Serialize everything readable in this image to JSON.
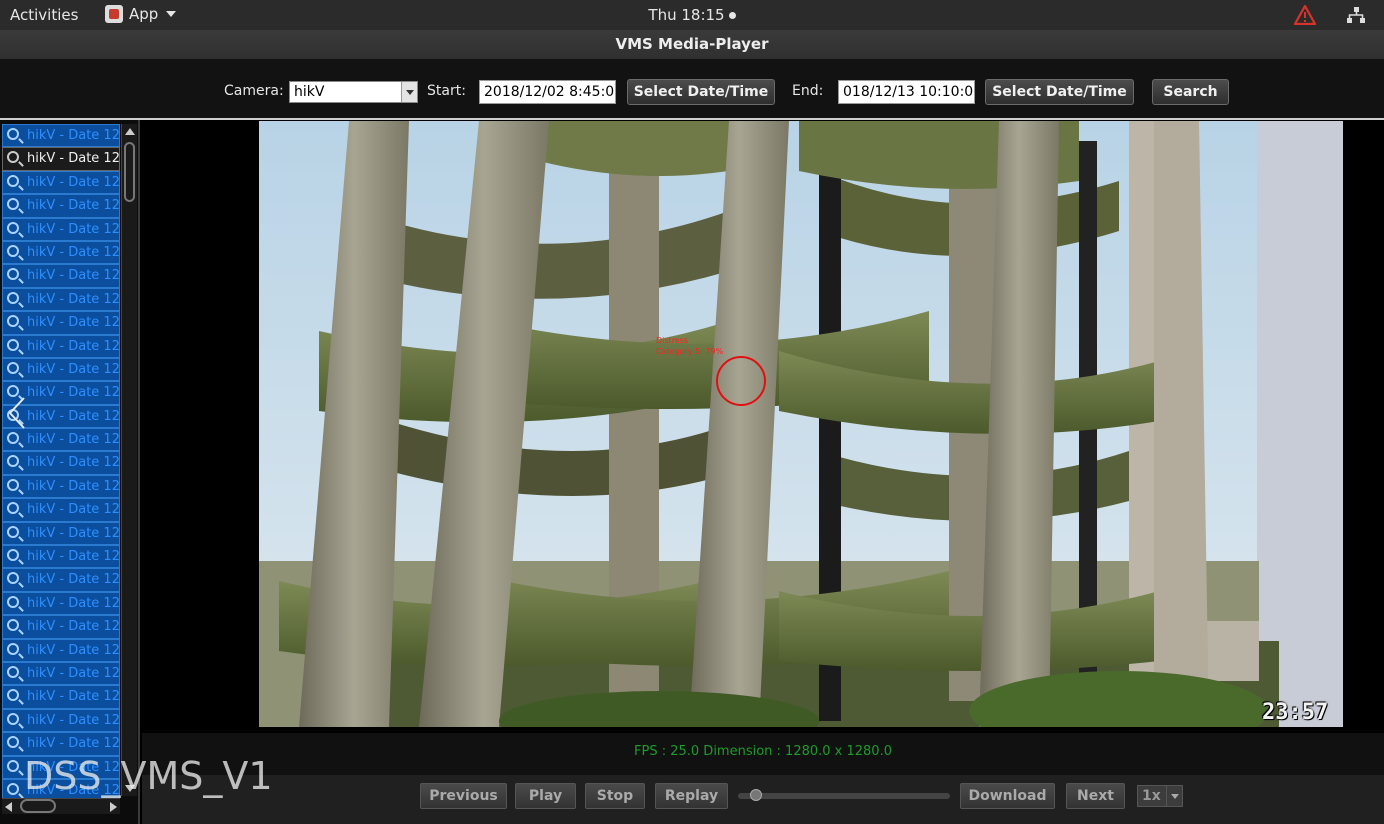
{
  "topbar": {
    "activities": "Activities",
    "app_label": "App",
    "clock": "Thu 18:15",
    "icons": [
      "app-icon",
      "warning-icon",
      "network-icon"
    ]
  },
  "window": {
    "title": "VMS Media-Player"
  },
  "toolbar": {
    "camera_label": "Camera:",
    "camera_value": "hikV",
    "start_label": "Start:",
    "start_value": "2018/12/02 8:45:0",
    "select_start_label": "Select Date/Time",
    "end_label": "End:",
    "end_value": "018/12/13 10:10:0",
    "select_end_label": "Select Date/Time",
    "search_label": "Search"
  },
  "recordings": {
    "selected_index": 1,
    "items": [
      "hikV - Date 12",
      "hikV - Date 12",
      "hikV - Date 12",
      "hikV - Date 12",
      "hikV - Date 12",
      "hikV - Date 12",
      "hikV - Date 12",
      "hikV - Date 12",
      "hikV - Date 12",
      "hikV - Date 12",
      "hikV - Date 12",
      "hikV - Date 12",
      "hikV - Date 12",
      "hikV - Date 12",
      "hikV - Date 12",
      "hikV - Date 12",
      "hikV - Date 12",
      "hikV - Date 12",
      "hikV - Date 12",
      "hikV - Date 12",
      "hikV - Date 12",
      "hikV - Date 12",
      "hikV - Date 12",
      "hikV - Date 12",
      "hikV - Date 12",
      "hikV - Date 12",
      "hikV - Date 12",
      "hikV - Date 12",
      "hikV - Date 12",
      "hikV - Date 12"
    ]
  },
  "video": {
    "timestamp": "23:57",
    "detection_line1": "Distress",
    "detection_line2": "Category 5: 79%"
  },
  "info": {
    "fps_text": "FPS : 25.0   Dimension : 1280.0 x 1280.0"
  },
  "controls": {
    "previous": "Previous",
    "play": "Play",
    "stop": "Stop",
    "replay": "Replay",
    "download": "Download",
    "next": "Next",
    "speed": "1x",
    "progress_fraction": 0.06
  },
  "watermark": "DSS_VMS_V1",
  "colors": {
    "list_item_bg": "#0b4e9e",
    "list_item_text": "#2d8fff",
    "info_text": "#1c9c2a",
    "detection": "#ff1f1f"
  }
}
